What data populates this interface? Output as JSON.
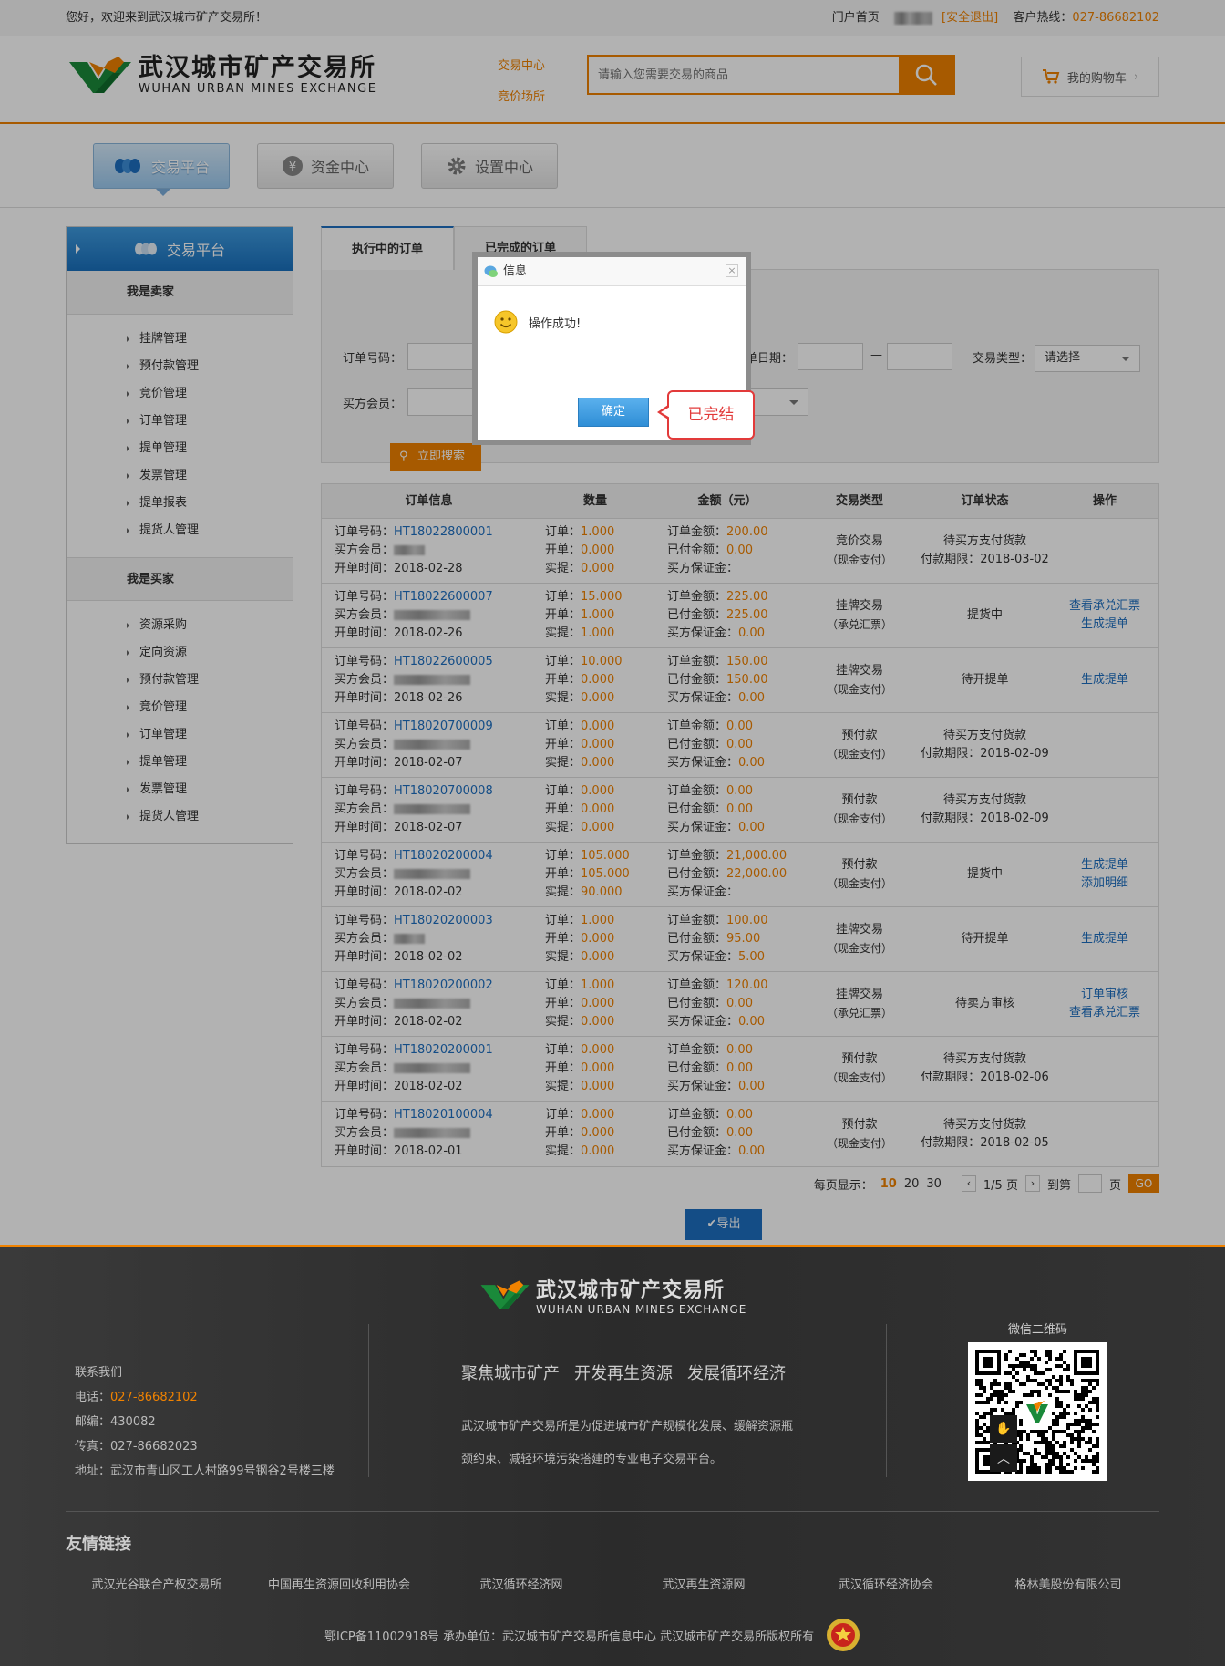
{
  "topbar": {
    "welcome": "您好，欢迎来到武汉城市矿产交易所！",
    "home": "门户首页",
    "logout": "[安全退出]",
    "hotline_label": "客户热线：",
    "hotline": "027-86682102"
  },
  "header": {
    "logo_cn": "武汉城市矿产交易所",
    "logo_en": "WUHAN URBAN MINES EXCHANGE",
    "link_trade": "交易中心",
    "link_auction": "竞价场所",
    "search_placeholder": "请输入您需要交易的商品",
    "cart": "我的购物车"
  },
  "nav": {
    "trade": "交易平台",
    "funds": "资金中心",
    "settings": "设置中心"
  },
  "sidebar": {
    "title": "交易平台",
    "seller_title": "我是卖家",
    "seller_items": [
      "挂牌管理",
      "预付款管理",
      "竞价管理",
      "订单管理",
      "提单管理",
      "发票管理",
      "提单报表",
      "提货人管理"
    ],
    "buyer_title": "我是买家",
    "buyer_items": [
      "资源采购",
      "定向资源",
      "预付款管理",
      "竞价管理",
      "订单管理",
      "提单管理",
      "发票管理",
      "提货人管理"
    ]
  },
  "tabs": {
    "active": "执行中的订单",
    "done": "已完成的订单"
  },
  "filter": {
    "order_no": "订单号码：",
    "date": "单日期：",
    "trade_type": "交易类型：",
    "trade_type_value": "请选择",
    "buyer": "买方会员：",
    "search_btn": "立即搜索"
  },
  "table": {
    "headers": [
      "订单信息",
      "数量",
      "金额（元）",
      "交易类型",
      "订单状态",
      "操作"
    ],
    "labels": {
      "order_no": "订单号码：",
      "buyer": "买方会员：",
      "open_time": "开单时间：",
      "q_order": "订单：",
      "q_open": "开单：",
      "q_real": "实提：",
      "a_order": "订单金额：",
      "a_paid": "已付金额：",
      "a_deposit": "买方保证金："
    },
    "rows": [
      {
        "no": "HT18022800001",
        "time": "2018-02-28",
        "q1": "1.000",
        "q2": "0.000",
        "q3": "0.000",
        "a1": "200.00",
        "a2": "0.00",
        "a3": "",
        "type": "竞价交易",
        "pay": "（现金支付）",
        "status": "待买方支付货款",
        "status2": "付款期限：2018-03-02",
        "ops": []
      },
      {
        "no": "HT18022600007",
        "time": "2018-02-26",
        "q1": "15.000",
        "q2": "1.000",
        "q3": "1.000",
        "a1": "225.00",
        "a2": "225.00",
        "a3": "0.00",
        "type": "挂牌交易",
        "pay": "（承兑汇票）",
        "status": "提货中",
        "status2": "",
        "ops": [
          "查看承兑汇票",
          "生成提单"
        ]
      },
      {
        "no": "HT18022600005",
        "time": "2018-02-26",
        "q1": "10.000",
        "q2": "0.000",
        "q3": "0.000",
        "a1": "150.00",
        "a2": "150.00",
        "a3": "0.00",
        "type": "挂牌交易",
        "pay": "（现金支付）",
        "status": "待开提单",
        "status2": "",
        "ops": [
          "生成提单"
        ]
      },
      {
        "no": "HT18020700009",
        "time": "2018-02-07",
        "q1": "0.000",
        "q2": "0.000",
        "q3": "0.000",
        "a1": "0.00",
        "a2": "0.00",
        "a3": "0.00",
        "type": "预付款",
        "pay": "（现金支付）",
        "status": "待买方支付货款",
        "status2": "付款期限：2018-02-09",
        "ops": []
      },
      {
        "no": "HT18020700008",
        "time": "2018-02-07",
        "q1": "0.000",
        "q2": "0.000",
        "q3": "0.000",
        "a1": "0.00",
        "a2": "0.00",
        "a3": "0.00",
        "type": "预付款",
        "pay": "（现金支付）",
        "status": "待买方支付货款",
        "status2": "付款期限：2018-02-09",
        "ops": []
      },
      {
        "no": "HT18020200004",
        "time": "2018-02-02",
        "q1": "105.000",
        "q2": "105.000",
        "q3": "90.000",
        "a1": "21,000.00",
        "a2": "22,000.00",
        "a3": "",
        "type": "预付款",
        "pay": "（现金支付）",
        "status": "提货中",
        "status2": "",
        "ops": [
          "生成提单",
          "添加明细"
        ]
      },
      {
        "no": "HT18020200003",
        "time": "2018-02-02",
        "q1": "1.000",
        "q2": "0.000",
        "q3": "0.000",
        "a1": "100.00",
        "a2": "95.00",
        "a3": "5.00",
        "type": "挂牌交易",
        "pay": "（现金支付）",
        "status": "待开提单",
        "status2": "",
        "ops": [
          "生成提单"
        ]
      },
      {
        "no": "HT18020200002",
        "time": "2018-02-02",
        "q1": "1.000",
        "q2": "0.000",
        "q3": "0.000",
        "a1": "120.00",
        "a2": "0.00",
        "a3": "0.00",
        "type": "挂牌交易",
        "pay": "（承兑汇票）",
        "status": "待卖方审核",
        "status2": "",
        "ops": [
          "订单审核",
          "查看承兑汇票"
        ]
      },
      {
        "no": "HT18020200001",
        "time": "2018-02-02",
        "q1": "0.000",
        "q2": "0.000",
        "q3": "0.000",
        "a1": "0.00",
        "a2": "0.00",
        "a3": "0.00",
        "type": "预付款",
        "pay": "（现金支付）",
        "status": "待买方支付货款",
        "status2": "付款期限：2018-02-06",
        "ops": []
      },
      {
        "no": "HT18020100004",
        "time": "2018-02-01",
        "q1": "0.000",
        "q2": "0.000",
        "q3": "0.000",
        "a1": "0.00",
        "a2": "0.00",
        "a3": "0.00",
        "type": "预付款",
        "pay": "（现金支付）",
        "status": "待买方支付货款",
        "status2": "付款期限：2018-02-05",
        "ops": []
      }
    ]
  },
  "pager": {
    "per_page": "每页显示：",
    "size_current": "10",
    "size_20": "20",
    "size_30": "30",
    "page_info": "1/5 页",
    "goto": "到第",
    "page_unit": "页",
    "go": "GO",
    "prev": "‹",
    "next": "›"
  },
  "export": "导出",
  "dialog": {
    "title": "信息",
    "message": "操作成功!",
    "ok": "确定",
    "close": "×",
    "callout": "已完结"
  },
  "footer": {
    "logo_cn": "武汉城市矿产交易所",
    "logo_en": "WUHAN URBAN MINES EXCHANGE",
    "contact_title": "联系我们",
    "phone_label": "电话：",
    "phone": "027-86682102",
    "zip": "邮编：430082",
    "fax": "传真：027-86682023",
    "address": "地址：武汉市青山区工人村路99号钢谷2号楼三楼",
    "slogan1": "聚焦城市矿产",
    "slogan2": "开发再生资源",
    "slogan3": "发展循环经济",
    "desc": "武汉城市矿产交易所是为促进城市矿产规模化发展、缓解资源瓶颈约束、减轻环境污染搭建的专业电子交易平台。",
    "qr_title": "微信二维码",
    "links_title": "友情链接",
    "links": [
      "武汉光谷联合产权交易所",
      "中国再生资源回收利用协会",
      "武汉循环经济网",
      "武汉再生资源网",
      "武汉循环经济协会",
      "格林美股份有限公司"
    ],
    "icp": "鄂ICP备11002918号   承办单位：武汉城市矿产交易所信息中心   武汉城市矿产交易所版权所有"
  }
}
